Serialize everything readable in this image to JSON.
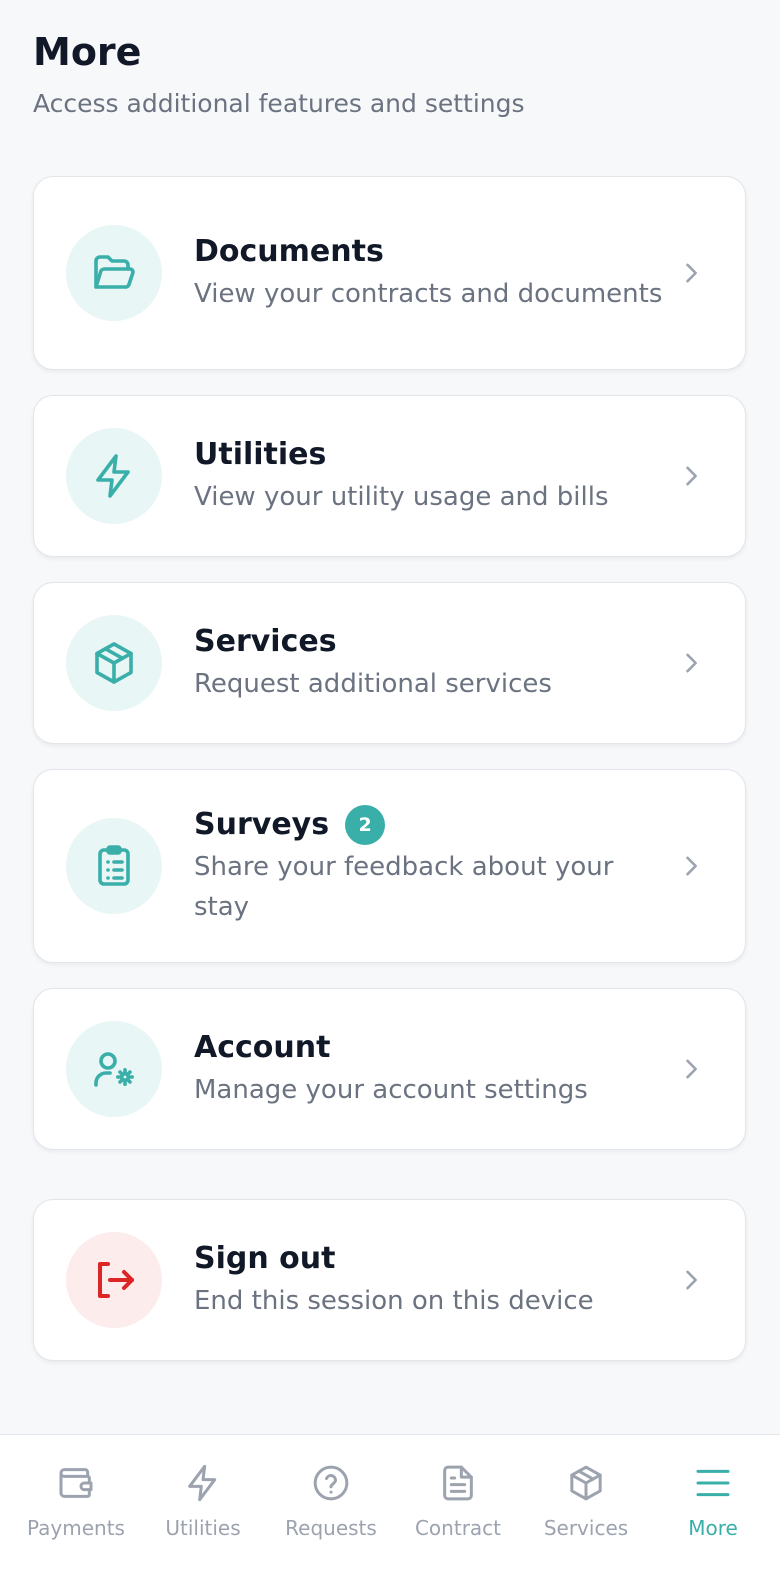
{
  "header": {
    "title": "More",
    "subtitle": "Access additional features and settings"
  },
  "menu": {
    "documents": {
      "title": "Documents",
      "description": "View your contracts and documents",
      "icon": "folder-icon"
    },
    "utilities": {
      "title": "Utilities",
      "description": "View your utility usage and bills",
      "icon": "lightning-icon"
    },
    "services": {
      "title": "Services",
      "description": "Request additional services",
      "icon": "package-icon"
    },
    "surveys": {
      "title": "Surveys",
      "badge": "2",
      "description": "Share your feedback about your stay",
      "icon": "clipboard-icon"
    },
    "account": {
      "title": "Account",
      "description": "Manage your account settings",
      "icon": "user-settings-icon"
    },
    "sign_out": {
      "title": "Sign out",
      "description": "End this session on this device",
      "icon": "sign-out-icon"
    }
  },
  "bottom_nav": {
    "items": [
      {
        "label": "Payments",
        "icon": "wallet-icon"
      },
      {
        "label": "Utilities",
        "icon": "lightning-icon"
      },
      {
        "label": "Requests",
        "icon": "help-circle-icon"
      },
      {
        "label": "Contract",
        "icon": "document-icon"
      },
      {
        "label": "Services",
        "icon": "package-icon"
      },
      {
        "label": "More",
        "icon": "menu-icon",
        "active": true
      }
    ]
  },
  "colors": {
    "accent": "#3aafa9",
    "accent_soft": "#e8f6f5",
    "danger": "#dc2626",
    "danger_soft": "#fdecec",
    "text_primary": "#111827",
    "text_secondary": "#6b7280",
    "nav_inactive": "#9ca3af"
  }
}
